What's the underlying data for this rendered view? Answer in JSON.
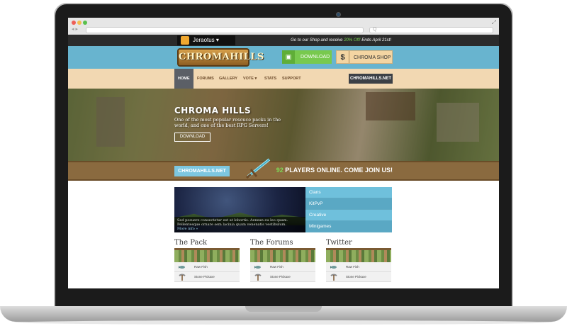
{
  "browser": {
    "search_placeholder": "Q"
  },
  "topbar": {
    "username": "Jeraotus ▾",
    "promo_prefix": "Go to our Shop and receive ",
    "promo_highlight": "20% Off!",
    "promo_suffix": " Ends April 21st!"
  },
  "header": {
    "logo_text": "CHROMAHILLS",
    "download_label": "DOWNLOAD",
    "shop_label": "CHROMA SHOP",
    "shop_icon": "$"
  },
  "nav": {
    "items": [
      "HOME",
      "FORUMS",
      "GALLERY",
      "VOTE ▾",
      "STATS",
      "SUPPORT"
    ],
    "cta": "CHROMAHILLS.NET"
  },
  "hero": {
    "title": "CHROMA HILLS",
    "text": "One of the most popular resouce packs in the world, and one of the best RPG Servers!",
    "button": "DOWNLOAD"
  },
  "status_bar": {
    "site": "CHROMAHILLS.NET",
    "players_count": "92",
    "players_text": " PLAYERS ONLINE. COME JOIN US!"
  },
  "slider": {
    "caption": "Sed posuere consectetur est at lobortis. Aenean eu leo quam. Pellentesque ornare sem lacinia quam venenatis vestibulum.",
    "more": "More info »"
  },
  "side_menu": [
    "Clans",
    "KitPvP",
    "Creative",
    "Minigames"
  ],
  "columns": [
    {
      "title": "The Pack",
      "rows": [
        "Raw Fish",
        "Stone Pickaxe"
      ]
    },
    {
      "title": "The Forums",
      "rows": [
        "Raw Fish",
        "Stone Pickaxe"
      ]
    },
    {
      "title": "Twitter",
      "rows": [
        "Raw Fish",
        "Stone Pickaxe"
      ]
    }
  ],
  "colors": {
    "accent_blue": "#68b4cf",
    "green": "#78c94e",
    "tan": "#f2d8b2",
    "brown": "#8a6a3f"
  },
  "icons": [
    "user-avatar-icon",
    "download-box-icon",
    "dollar-icon",
    "sword-icon",
    "fish-icon",
    "pickaxe-icon"
  ]
}
